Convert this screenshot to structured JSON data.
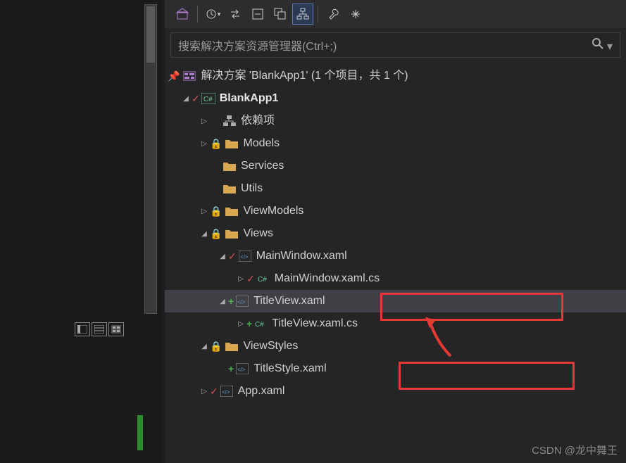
{
  "search": {
    "placeholder": "搜索解决方案资源管理器(Ctrl+;)"
  },
  "solution": {
    "label": "解决方案 'BlankApp1' (1 个项目，共 1 个)",
    "project": "BlankApp1",
    "deps": "依赖项",
    "folders": {
      "models": "Models",
      "services": "Services",
      "utils": "Utils",
      "viewmodels": "ViewModels",
      "views": "Views",
      "viewstyles": "ViewStyles"
    },
    "files": {
      "mainwindow": "MainWindow.xaml",
      "mainwindow_cs": "MainWindow.xaml.cs",
      "titleview": "TitleView.xaml",
      "titleview_cs": "TitleView.xaml.cs",
      "titlestyle": "TitleStyle.xaml",
      "app": "App.xaml"
    }
  },
  "watermark": "CSDN @龙中舞王"
}
